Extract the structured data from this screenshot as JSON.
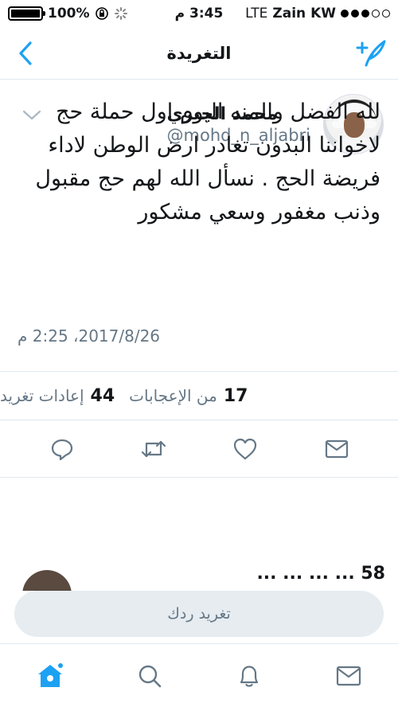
{
  "status_bar": {
    "battery": "100%",
    "time": "3:45 م",
    "network": "LTE",
    "carrier": "Zain KW",
    "battery_level": 1.0,
    "signal_bars": 3
  },
  "nav": {
    "title": "التغريدة"
  },
  "tweet": {
    "author_name": "محمد الجبري",
    "author_handle": "@mohd_n_aljabri",
    "text": "لله الفضل والمنه اليوم اول حملة حج لاخواننا البدون تغادر ارض الوطن لاداء فريضة الحج . نسأل الله لهم حج مقبول وذنب مغفور وسعي مشكور",
    "date": "2017/8/26، 2:25 م",
    "likes_count": "17",
    "likes_label": "من الإعجابات",
    "retweets_count": "44",
    "retweets_label": "إعادات تغريد"
  },
  "next_tweet": {
    "preview": "58 ... ... ... ..."
  },
  "reply": {
    "placeholder": "تغريد ردك"
  },
  "colors": {
    "accent": "#1da1f2",
    "muted": "#657786",
    "divider": "#e1e8ed"
  },
  "icons": {
    "back": "chevron-left-icon",
    "compose": "compose-feather-icon",
    "menu": "chevron-down-icon",
    "reply": "reply-bubble-icon",
    "retweet": "retweet-icon",
    "like": "heart-icon",
    "dm": "envelope-icon",
    "home": "home-icon",
    "search": "search-icon",
    "notifications": "bell-icon",
    "messages": "envelope-icon"
  }
}
